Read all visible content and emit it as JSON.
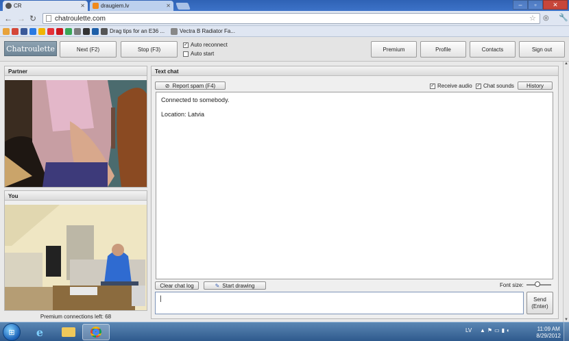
{
  "browser": {
    "tabs": [
      {
        "title": "CR",
        "active": true
      },
      {
        "title": "draugiem.lv",
        "active": false
      }
    ],
    "url": "chatroulette.com",
    "bookmarks": [
      {
        "label": "",
        "icon": "bookmark-apps",
        "color": "#e8a23a"
      },
      {
        "label": "",
        "icon": "gmail",
        "color": "#d44638"
      },
      {
        "label": "",
        "icon": "facebook",
        "color": "#3b5998"
      },
      {
        "label": "",
        "icon": "bookmark-blue",
        "color": "#2a7ae2"
      },
      {
        "label": "",
        "icon": "bookmark-yellow",
        "color": "#f0b400"
      },
      {
        "label": "",
        "icon": "ebay",
        "color": "#e53238"
      },
      {
        "label": "",
        "icon": "youtube",
        "color": "#cc181e"
      },
      {
        "label": "",
        "icon": "bookmark-green",
        "color": "#3aa757"
      },
      {
        "label": "",
        "icon": "bookmark-gray",
        "color": "#7a7a7a"
      },
      {
        "label": "",
        "icon": "bookmark-dark",
        "color": "#333333"
      },
      {
        "label": "",
        "icon": "bookmark-blue2",
        "color": "#1e5fa8"
      },
      {
        "label": "Drag tips for an E36 ...",
        "icon": "bookmark-car",
        "color": "#555555"
      },
      {
        "label": "Vectra B Radiator Fa...",
        "icon": "bookmark-page",
        "color": "#888888"
      }
    ]
  },
  "header": {
    "logo": "Chatroulette",
    "buttons": {
      "next": "Next (F2)",
      "stop": "Stop (F3)",
      "premium": "Premium",
      "profile": "Profile",
      "contacts": "Contacts",
      "signout": "Sign out"
    },
    "options": {
      "auto_reconnect": {
        "label": "Auto reconnect",
        "checked": true
      },
      "auto_start": {
        "label": "Auto start",
        "checked": false
      }
    }
  },
  "partner_panel": {
    "title": "Partner"
  },
  "you_panel": {
    "title": "You",
    "premium_connections": "Premium connections left: 68"
  },
  "chat": {
    "title": "Text chat",
    "report_spam": "Report spam (F4)",
    "receive_audio": {
      "label": "Receive audio",
      "checked": true
    },
    "chat_sounds": {
      "label": "Chat sounds",
      "checked": true
    },
    "history": "History",
    "messages": [
      "Connected to somebody.",
      "Location: Latvia"
    ],
    "clear_log": "Clear chat log",
    "start_drawing": "Start drawing",
    "font_size_label": "Font size:",
    "input_value": "",
    "send": "Send\n(Enter)"
  },
  "taskbar": {
    "language": "LV",
    "time": "11:09 AM",
    "date": "8/29/2012"
  }
}
